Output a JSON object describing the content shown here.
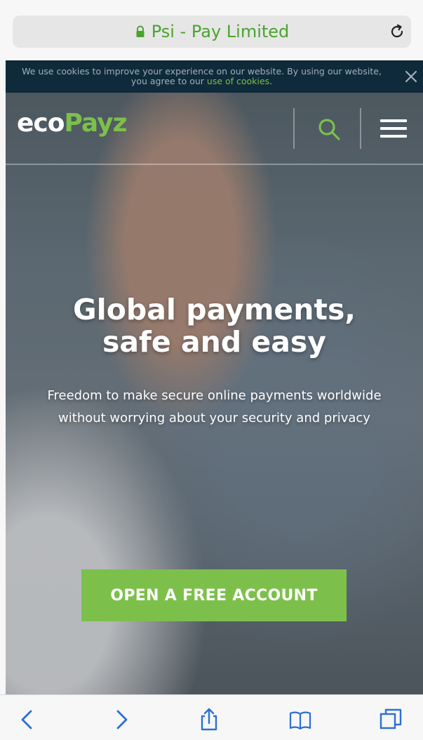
{
  "browser": {
    "title": "Psi - Pay Limited",
    "title_color": "#4ba32e"
  },
  "cookie_banner": {
    "text_before_link": "We use cookies to improve your experience on our website. By using our website, you agree to our ",
    "link_text": "use of cookies",
    "text_after_link": "."
  },
  "header": {
    "logo_part1": "eco",
    "logo_part2": "Payz",
    "brand_color": "#7cc04b",
    "icons": [
      "search-icon",
      "menu-icon"
    ]
  },
  "hero": {
    "headline_line1": "Global payments,",
    "headline_line2": "safe and easy",
    "subhead_line1": "Freedom to make secure online payments worldwide",
    "subhead_line2": "without worrying about your security and privacy",
    "cta_label": "OPEN A FREE ACCOUNT"
  },
  "toolbar": {
    "icons": [
      "back-icon",
      "forward-icon",
      "share-icon",
      "bookmarks-icon",
      "tabs-icon"
    ]
  }
}
